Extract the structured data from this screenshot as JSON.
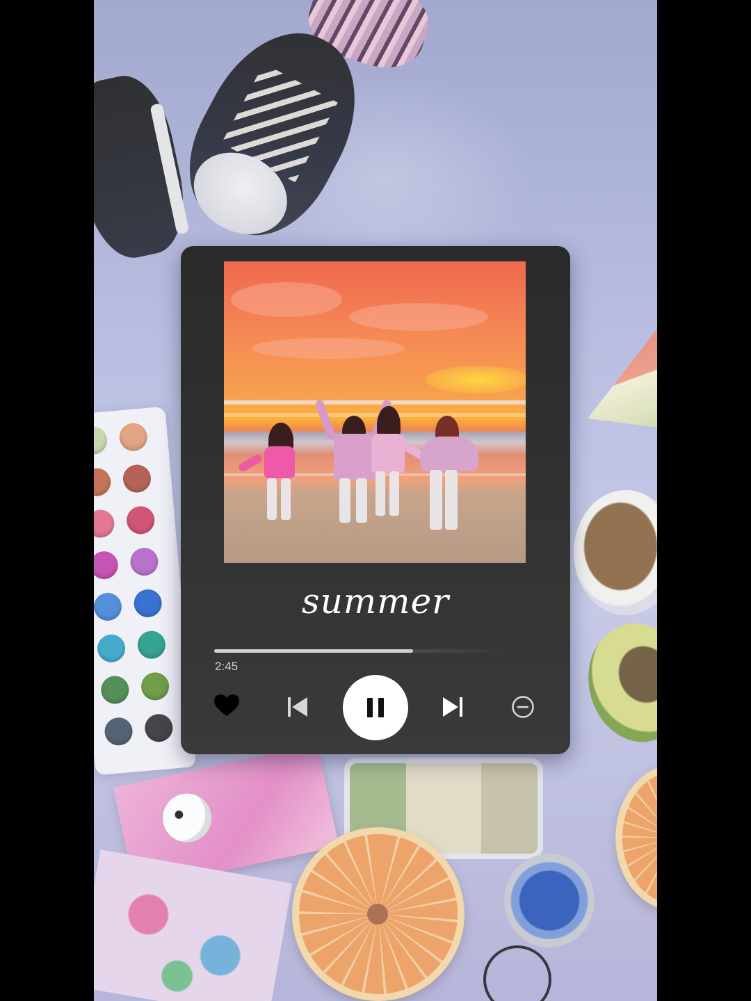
{
  "player": {
    "song_title": "summer",
    "elapsed_time": "2:45",
    "progress_fraction": 0.68,
    "state": "playing",
    "liked": true
  },
  "controls": {
    "like": "heart-icon",
    "previous": "skip-previous-icon",
    "play_pause": "pause-icon",
    "next": "skip-next-icon",
    "remove": "minus-circle-icon"
  },
  "colors": {
    "card_background": "#2f2f2f",
    "text": "#ffffff",
    "progress_fill": "#cfcfcf",
    "play_button": "#ffffff"
  }
}
